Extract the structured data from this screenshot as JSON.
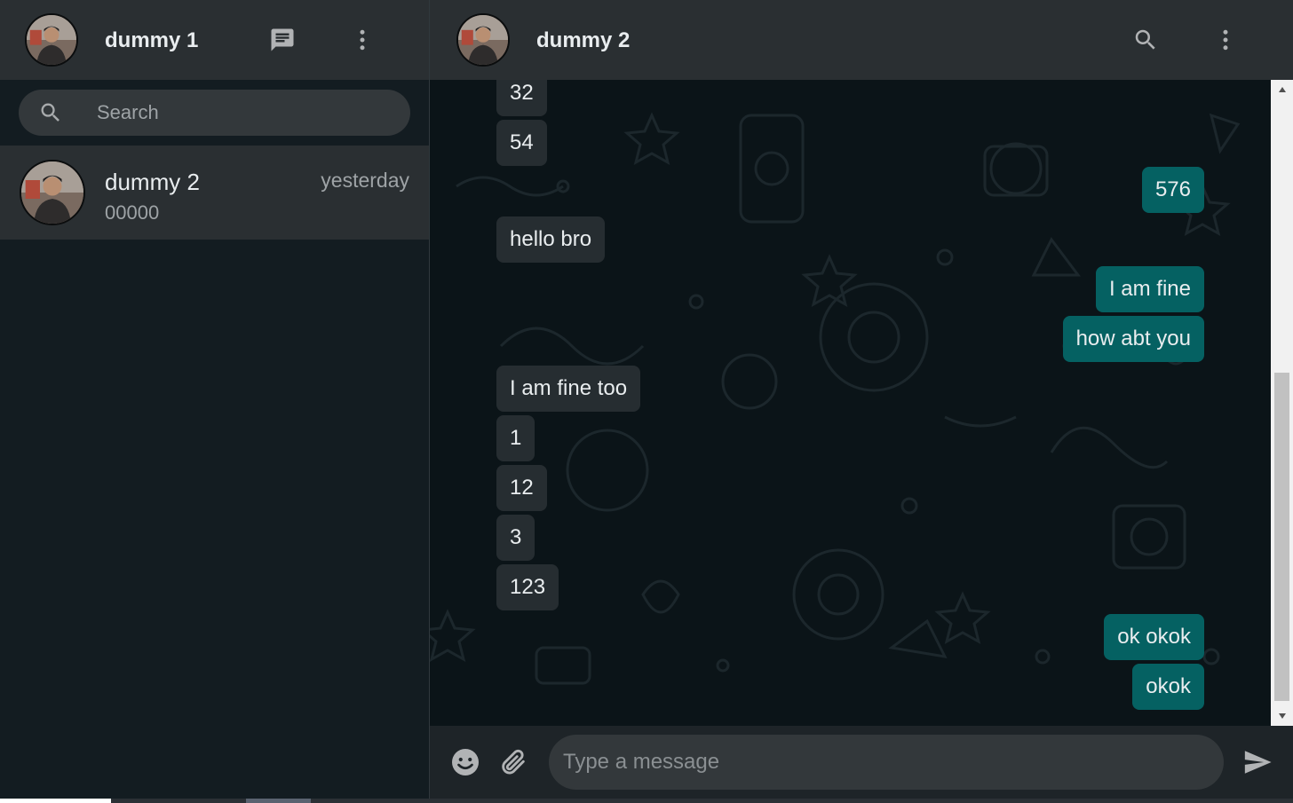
{
  "sidebar": {
    "user_name": "dummy 1",
    "icons": {
      "new_chat": "message-icon",
      "menu": "more-vert-icon"
    },
    "search": {
      "placeholder": "Search",
      "value": ""
    },
    "chats": [
      {
        "name": "dummy 2",
        "time": "yesterday",
        "preview": "00000"
      }
    ]
  },
  "conversation": {
    "contact_name": "dummy 2",
    "icons": {
      "search": "search-icon",
      "menu": "more-vert-icon"
    },
    "messages": [
      {
        "text": "32",
        "direction": "incoming"
      },
      {
        "text": "54",
        "direction": "incoming"
      },
      {
        "text": "576",
        "direction": "outgoing"
      },
      {
        "text": "hello bro",
        "direction": "incoming"
      },
      {
        "text": "I am fine",
        "direction": "outgoing"
      },
      {
        "text": "how abt you",
        "direction": "outgoing"
      },
      {
        "text": "I am fine too",
        "direction": "incoming"
      },
      {
        "text": "1",
        "direction": "incoming"
      },
      {
        "text": "12",
        "direction": "incoming"
      },
      {
        "text": "3",
        "direction": "incoming"
      },
      {
        "text": "123",
        "direction": "incoming"
      },
      {
        "text": "ok okok",
        "direction": "outgoing"
      },
      {
        "text": "okok",
        "direction": "outgoing"
      }
    ]
  },
  "composer": {
    "placeholder": "Type a message",
    "value": "",
    "icons": {
      "emoji": "emoji-icon",
      "attach": "paperclip-icon",
      "send": "send-icon"
    }
  },
  "colors": {
    "incoming_bubble": "#262d31",
    "outgoing_bubble": "#056162",
    "header": "#2a2f32",
    "chat_bg": "#0b1418"
  }
}
